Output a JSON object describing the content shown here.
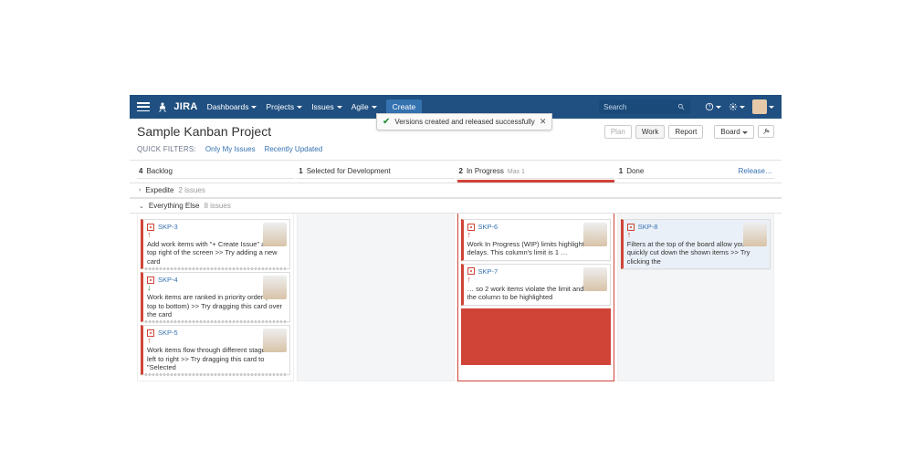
{
  "nav": {
    "logo": "JIRA",
    "items": [
      "Dashboards",
      "Projects",
      "Issues",
      "Agile"
    ],
    "create": "Create",
    "search_placeholder": "Search"
  },
  "toast": {
    "text": "Versions created and released successfully"
  },
  "header": {
    "title": "Sample Kanban Project",
    "buttons": {
      "plan": "Plan",
      "work": "Work",
      "report": "Report",
      "board": "Board",
      "tools": "⚒"
    }
  },
  "quickfilters": {
    "label": "QUICK FILTERS:",
    "only_my": "Only My Issues",
    "recently": "Recently Updated"
  },
  "columns": [
    {
      "count": "4",
      "name": "Backlog"
    },
    {
      "count": "1",
      "name": "Selected for Development"
    },
    {
      "count": "2",
      "name": "In Progress",
      "max": "Max 1"
    },
    {
      "count": "1",
      "name": "Done",
      "release": "Release…"
    }
  ],
  "swimlanes": {
    "expedite": {
      "name": "Expedite",
      "count": "2 issues"
    },
    "everything": {
      "name": "Everything Else",
      "count": "8 issues"
    }
  },
  "cards": {
    "skp3": {
      "key": "SKP-3",
      "summary": "Add work items with \"+ Create Issue\" at the top right of the screen >> Try adding a new card",
      "pri": "up"
    },
    "skp4": {
      "key": "SKP-4",
      "summary": "Work items are ranked in priority order (from top to bottom) >> Try dragging this card over the card",
      "pri": "down"
    },
    "skp5": {
      "key": "SKP-5",
      "summary": "Work items flow through different stages from left to right >> Try dragging this card to \"Selected",
      "pri": "up"
    },
    "skp6": {
      "key": "SKP-6",
      "summary": "Work In Progress (WIP) limits highlight delays. This column's limit is 1 …",
      "pri": "up"
    },
    "skp7": {
      "key": "SKP-7",
      "summary": "… so 2 work items violate the limit and cause the column to be highlighted",
      "pri": "up"
    },
    "skp8": {
      "key": "SKP-8",
      "summary": "Filters at the top of the board allow you to quickly cut down the shown items >> Try clicking the",
      "pri": "up"
    }
  }
}
